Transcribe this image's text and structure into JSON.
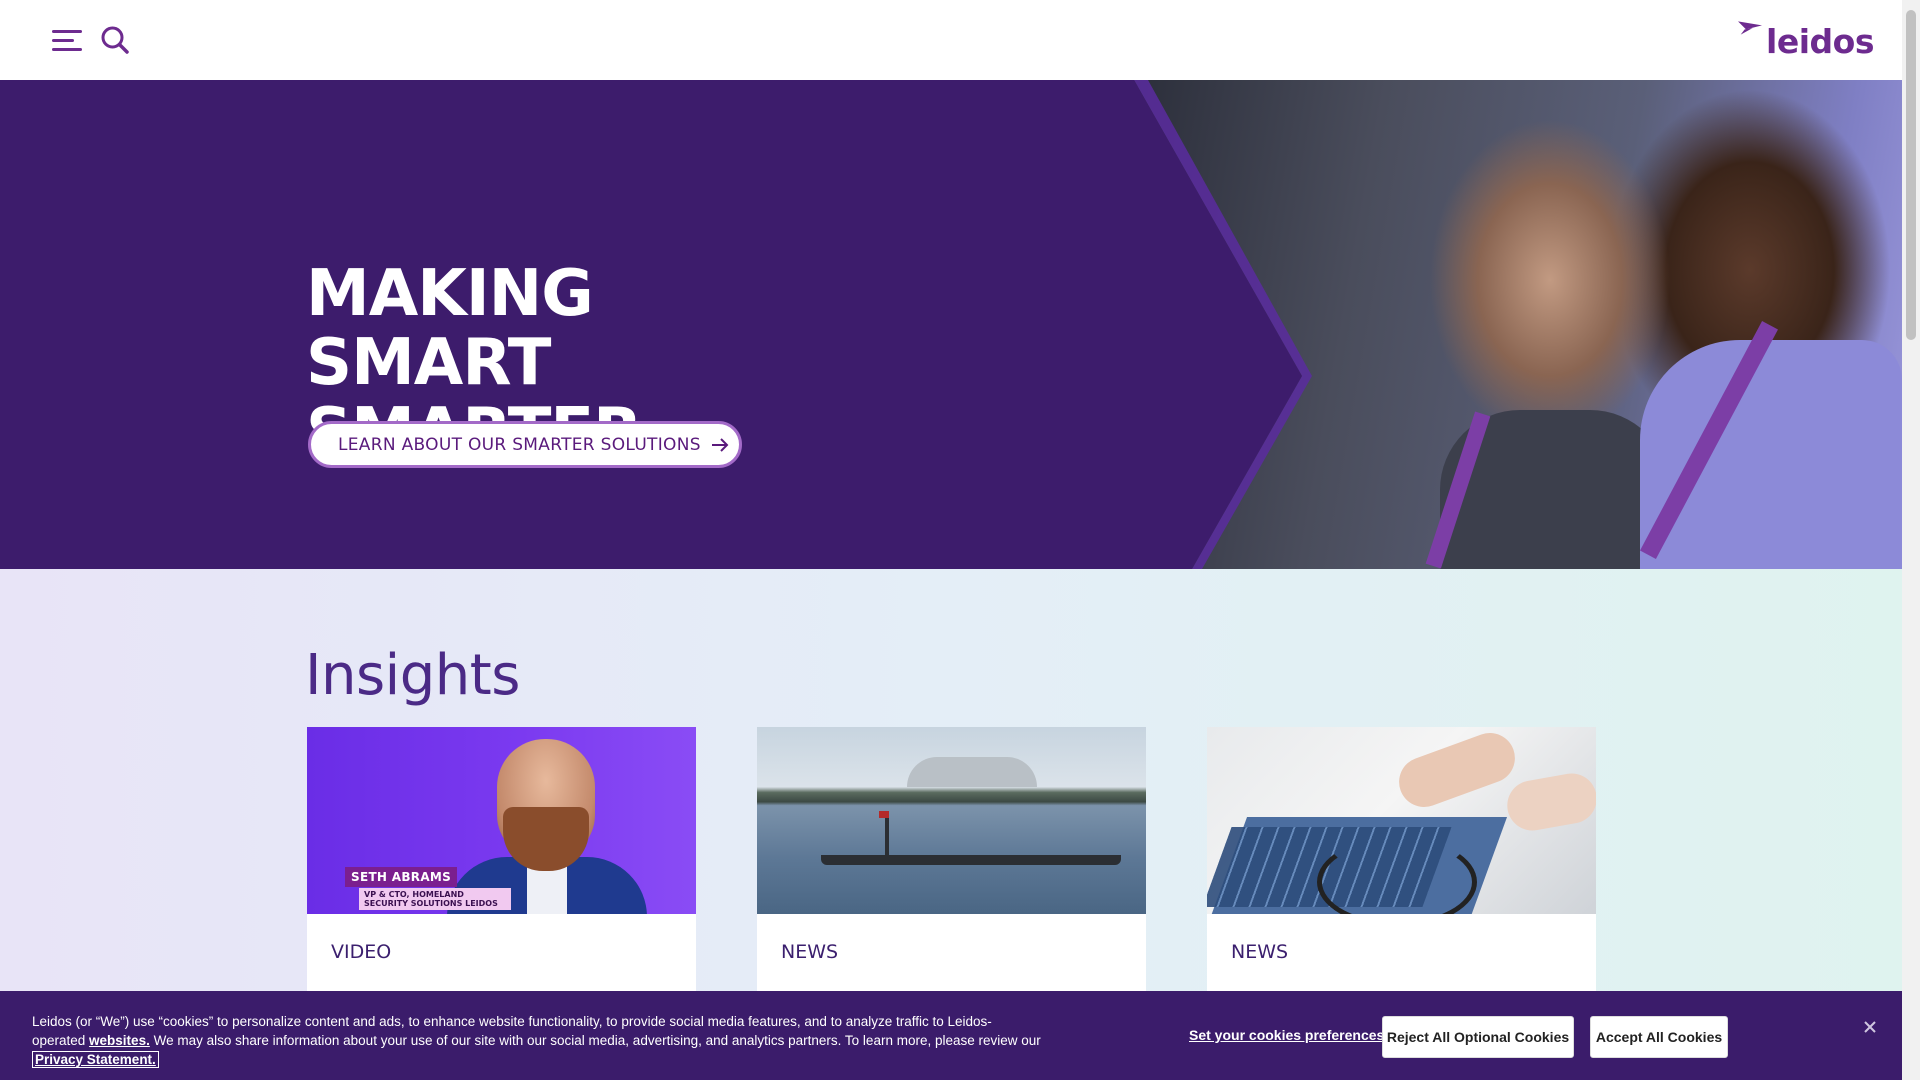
{
  "header": {
    "menu_icon": "hamburger-menu-icon",
    "search_icon": "search-icon",
    "logo_text": "leidos",
    "brand_color": "#6d2b8f"
  },
  "hero": {
    "title_lines": [
      "MAKING",
      "SMART",
      "SMARTER"
    ],
    "cta_label": "LEARN ABOUT OUR SMARTER SOLUTIONS",
    "cta_icon": "arrow-right-icon",
    "background_color": "#3d1c6c"
  },
  "insights": {
    "title": "Insights",
    "cards": [
      {
        "tag": "VIDEO",
        "image_caption_name": "SETH ABRAMS",
        "image_caption_title": "VP & CTO, HOMELAND SECURITY SOLUTIONS LEIDOS"
      },
      {
        "tag": "NEWS"
      },
      {
        "tag": "NEWS"
      }
    ]
  },
  "cookie_banner": {
    "text": "Leidos (or “We”) use “cookies” to personalize content and ads, to enhance website functionality, to provide social media features, and to analyze traffic to Leidos-operated ",
    "websites_link": "websites.",
    "text_middle": " We may also share information about your use of our site with our social media, advertising, and analytics partners. To learn more, please review our ",
    "privacy_link": "Privacy Statement.",
    "preferences_label": "Set your cookies preferences",
    "reject_label": "Reject All Optional Cookies",
    "accept_label": "Accept All Cookies",
    "close_icon": "close-icon",
    "background_color": "#3b1c6b"
  }
}
